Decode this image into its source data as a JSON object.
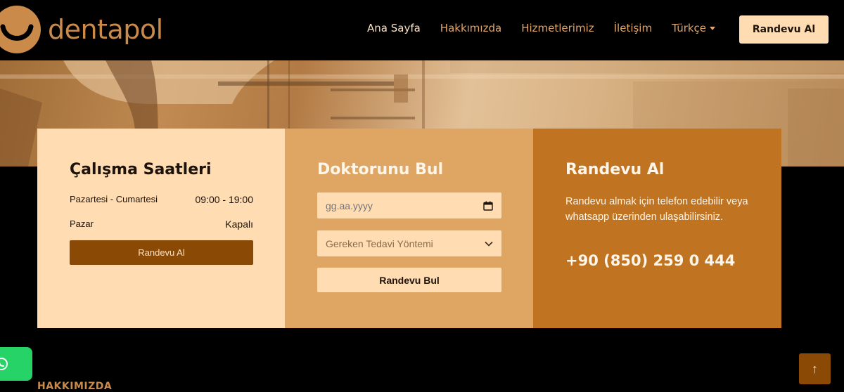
{
  "brand": {
    "name": "dentapol",
    "logo_icon": "smile-logo-icon",
    "color": "#c98a4a"
  },
  "nav": {
    "items": [
      {
        "label": "Ana Sayfa",
        "active": true
      },
      {
        "label": "Hakkımızda"
      },
      {
        "label": "Hizmetlerimiz"
      },
      {
        "label": "İletişim"
      },
      {
        "label": "Türkçe",
        "dropdown": true
      }
    ],
    "cta": "Randevu Al"
  },
  "hours_card": {
    "title": "Çalışma Saatleri",
    "rows": [
      {
        "day": "Pazartesi - Cumartesi",
        "time": "09:00 - 19:00"
      },
      {
        "day": "Pazar",
        "time": "Kapalı"
      }
    ],
    "button": "Randevu Al"
  },
  "doctor_card": {
    "title": "Doktorunu Bul",
    "date_placeholder": "gg.aa.yyyy",
    "date_icon": "calendar-icon",
    "select_value": "Gereken Tedavi Yöntemi",
    "select_icon": "chevron-down-icon",
    "button": "Randevu Bul"
  },
  "appointment_card": {
    "title": "Randevu Al",
    "text": "Randevu almak için telefon edebilir veya whatsapp üzerinden ulaşabilirsiniz.",
    "phone": "+90 (850) 259 0 444"
  },
  "section_label": "HAKKIMIZDA",
  "floating": {
    "whatsapp_icon": "whatsapp-icon",
    "top_icon": "arrow-up-icon",
    "top_glyph": "↑"
  },
  "colors": {
    "light": "#ffdcb2",
    "mid": "#dea563",
    "dark": "#c07321",
    "brown": "#8a4a06",
    "whatsapp": "#25d366"
  }
}
